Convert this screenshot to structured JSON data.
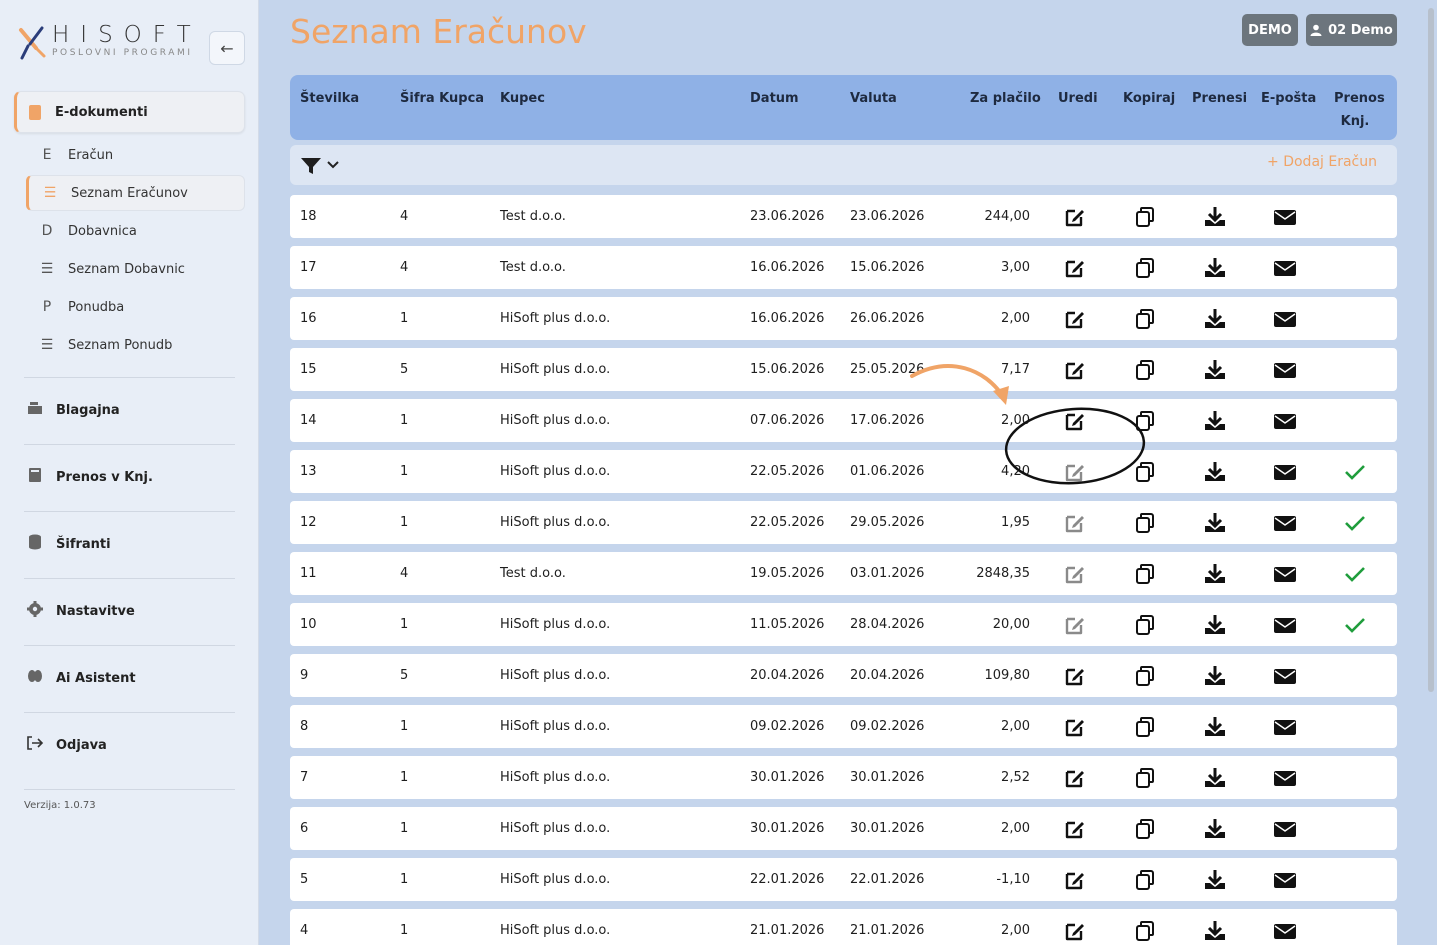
{
  "brand": {
    "name": "HISOFT",
    "subtitle": "POSLOVNI PROGRAMI"
  },
  "sidebar": {
    "group_label": "E-dokumenti",
    "sub_items": [
      {
        "glyph": "E",
        "label": "Eračun"
      },
      {
        "glyph": "☰",
        "label": "Seznam Eračunov"
      },
      {
        "glyph": "D",
        "label": "Dobavnica"
      },
      {
        "glyph": "☰",
        "label": "Seznam Dobavnic"
      },
      {
        "glyph": "P",
        "label": "Ponudba"
      },
      {
        "glyph": "☰",
        "label": "Seznam Ponudb"
      }
    ],
    "main_items": [
      {
        "label": "Blagajna",
        "icon": "register-icon"
      },
      {
        "label": "Prenos v Knj.",
        "icon": "book-icon"
      },
      {
        "label": "Šifranti",
        "icon": "database-icon"
      },
      {
        "label": "Nastavitve",
        "icon": "gear-icon"
      },
      {
        "label": "Ai Asistent",
        "icon": "brain-icon"
      },
      {
        "label": "Odjava",
        "icon": "logout-icon"
      }
    ],
    "version": "Verzija: 1.0.73"
  },
  "header": {
    "title": "Seznam Eračunov",
    "demo_label": "DEMO",
    "user_label": "02 Demo"
  },
  "table": {
    "columns": [
      "Številka",
      "Šifra Kupca",
      "Kupec",
      "Datum",
      "Valuta",
      "Za plačilo",
      "Uredi",
      "Kopiraj",
      "Prenesi",
      "E-pošta",
      "Prenos Knj."
    ],
    "add_label": "+ Dodaj Eračun",
    "rows": [
      {
        "st": "18",
        "sifra": "4",
        "kupec": "Test d.o.o.",
        "datum": "23.06.2026",
        "valuta": "23.06.2026",
        "znesek": "244,00",
        "editable": true,
        "prenos": false
      },
      {
        "st": "17",
        "sifra": "4",
        "kupec": "Test d.o.o.",
        "datum": "16.06.2026",
        "valuta": "15.06.2026",
        "znesek": "3,00",
        "editable": true,
        "prenos": false
      },
      {
        "st": "16",
        "sifra": "1",
        "kupec": "HiSoft plus d.o.o.",
        "datum": "16.06.2026",
        "valuta": "26.06.2026",
        "znesek": "2,00",
        "editable": true,
        "prenos": false
      },
      {
        "st": "15",
        "sifra": "5",
        "kupec": "HiSoft plus d.o.o.",
        "datum": "15.06.2026",
        "valuta": "25.05.2026",
        "znesek": "7,17",
        "editable": true,
        "prenos": false
      },
      {
        "st": "14",
        "sifra": "1",
        "kupec": "HiSoft plus d.o.o.",
        "datum": "07.06.2026",
        "valuta": "17.06.2026",
        "znesek": "2,00",
        "editable": true,
        "prenos": false
      },
      {
        "st": "13",
        "sifra": "1",
        "kupec": "HiSoft plus d.o.o.",
        "datum": "22.05.2026",
        "valuta": "01.06.2026",
        "znesek": "4,20",
        "editable": false,
        "prenos": true
      },
      {
        "st": "12",
        "sifra": "1",
        "kupec": "HiSoft plus d.o.o.",
        "datum": "22.05.2026",
        "valuta": "29.05.2026",
        "znesek": "1,95",
        "editable": false,
        "prenos": true
      },
      {
        "st": "11",
        "sifra": "4",
        "kupec": "Test d.o.o.",
        "datum": "19.05.2026",
        "valuta": "03.01.2026",
        "znesek": "2848,35",
        "editable": false,
        "prenos": true
      },
      {
        "st": "10",
        "sifra": "1",
        "kupec": "HiSoft plus d.o.o.",
        "datum": "11.05.2026",
        "valuta": "28.04.2026",
        "znesek": "20,00",
        "editable": false,
        "prenos": true
      },
      {
        "st": "9",
        "sifra": "5",
        "kupec": "HiSoft plus d.o.o.",
        "datum": "20.04.2026",
        "valuta": "20.04.2026",
        "znesek": "109,80",
        "editable": true,
        "prenos": false
      },
      {
        "st": "8",
        "sifra": "1",
        "kupec": "HiSoft plus d.o.o.",
        "datum": "09.02.2026",
        "valuta": "09.02.2026",
        "znesek": "2,00",
        "editable": true,
        "prenos": false
      },
      {
        "st": "7",
        "sifra": "1",
        "kupec": "HiSoft plus d.o.o.",
        "datum": "30.01.2026",
        "valuta": "30.01.2026",
        "znesek": "2,52",
        "editable": true,
        "prenos": false
      },
      {
        "st": "6",
        "sifra": "1",
        "kupec": "HiSoft plus d.o.o.",
        "datum": "30.01.2026",
        "valuta": "30.01.2026",
        "znesek": "2,00",
        "editable": true,
        "prenos": false
      },
      {
        "st": "5",
        "sifra": "1",
        "kupec": "HiSoft plus d.o.o.",
        "datum": "22.01.2026",
        "valuta": "22.01.2026",
        "znesek": "-1,10",
        "editable": true,
        "prenos": false
      },
      {
        "st": "4",
        "sifra": "1",
        "kupec": "HiSoft plus d.o.o.",
        "datum": "21.01.2026",
        "valuta": "21.01.2026",
        "znesek": "2,00",
        "editable": true,
        "prenos": false
      }
    ]
  },
  "colors": {
    "accent": "#f0a467",
    "header_bg": "#8fb1e6",
    "check": "#1f9d3c",
    "muted_icon": "#8a8a8a"
  }
}
